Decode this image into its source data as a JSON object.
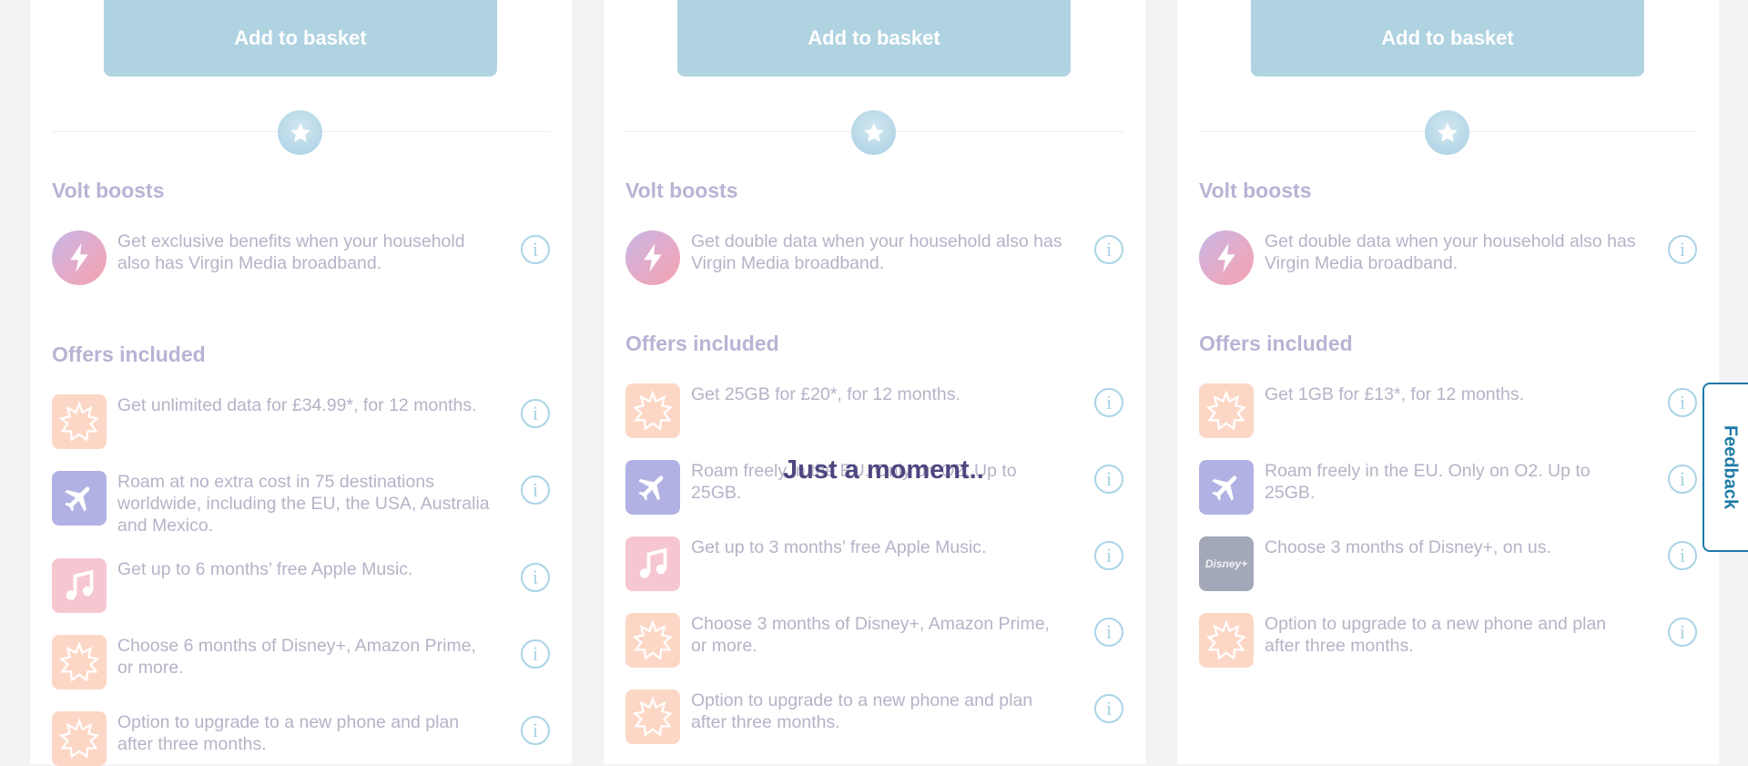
{
  "overlay_text": "Just a moment..",
  "feedback_label": "Feedback",
  "colors": {
    "button": "#b0d3e1",
    "section_title": "#b7b4d4",
    "info_icon": "#a9d4e5",
    "feedback": "#1e7aa6"
  },
  "cards": [
    {
      "button_label": "Add to basket",
      "volt_title": "Volt boosts",
      "volt_text": "Get exclusive benefits when your household also has Virgin Media broadband.",
      "offers_title": "Offers included",
      "offers": [
        {
          "icon": "burst-icon",
          "text": "Get unlimited data for £34.99*, for 12 months."
        },
        {
          "icon": "airplane-icon",
          "text": "Roam at no extra cost in 75 destinations worldwide, including the EU, the USA, Australia and Mexico."
        },
        {
          "icon": "music-note-icon",
          "text": "Get up to 6 months’ free Apple Music."
        },
        {
          "icon": "burst-icon",
          "text": "Choose 6 months of Disney+, Amazon Prime, or more."
        },
        {
          "icon": "burst-icon",
          "text": "Option to upgrade to a new phone and plan after three months."
        }
      ]
    },
    {
      "button_label": "Add to basket",
      "volt_title": "Volt boosts",
      "volt_text": "Get double data when your household also has Virgin Media broadband.",
      "offers_title": "Offers included",
      "offers": [
        {
          "icon": "burst-icon",
          "text": "Get 25GB for £20*, for 12 months."
        },
        {
          "icon": "airplane-icon",
          "text": "Roam freely in the EU. Only on O2. Up to 25GB."
        },
        {
          "icon": "music-note-icon",
          "text": "Get up to 3 months’ free Apple Music."
        },
        {
          "icon": "burst-icon",
          "text": "Choose 3 months of Disney+, Amazon Prime, or more."
        },
        {
          "icon": "burst-icon",
          "text": "Option to upgrade to a new phone and plan after three months."
        }
      ]
    },
    {
      "button_label": "Add to basket",
      "volt_title": "Volt boosts",
      "volt_text": "Get double data when your household also has Virgin Media broadband.",
      "offers_title": "Offers included",
      "offers": [
        {
          "icon": "burst-icon",
          "text": "Get 1GB for £13*, for 12 months."
        },
        {
          "icon": "airplane-icon",
          "text": "Roam freely in the EU. Only on O2. Up to 25GB."
        },
        {
          "icon": "disney-plus-icon",
          "text": "Choose 3 months of Disney+, on us.",
          "icon_label": "Disney+"
        },
        {
          "icon": "burst-icon",
          "text": "Option to upgrade to a new phone and plan after three months."
        }
      ]
    }
  ]
}
